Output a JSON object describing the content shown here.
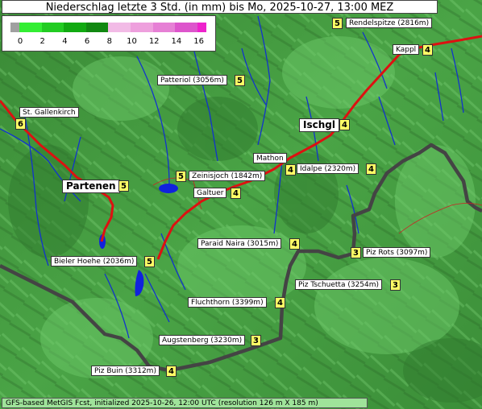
{
  "title": "Niederschlag letzte 3 Std. (in mm) bis Mo, 2025-10-27, 13:00 MEZ",
  "legend": {
    "ticks": [
      "0",
      "2",
      "4",
      "6",
      "8",
      "10",
      "12",
      "14",
      "16"
    ],
    "colors": [
      "#a0a0a0",
      "#33ee33",
      "#22cc22",
      "#11aa11",
      "#118811",
      "#f2bbe6",
      "#eea0dd",
      "#e680d5",
      "#dd55cc",
      "#ee22cc"
    ]
  },
  "places": [
    {
      "name": "Rendelspitze (2816m)",
      "value": "5"
    },
    {
      "name": "Kappl",
      "value": "4"
    },
    {
      "name": "Patteriol (3056m)",
      "value": "5"
    },
    {
      "name": "St. Gallenkirch",
      "value": "6"
    },
    {
      "name": "Ischgl",
      "value": "4"
    },
    {
      "name": "Mathon",
      "value": "4"
    },
    {
      "name": "Idalpe (2320m)",
      "value": "4"
    },
    {
      "name": "Zeinisjoch (1842m)",
      "value": "5"
    },
    {
      "name": "Partenen",
      "value": "5"
    },
    {
      "name": "Galtuer",
      "value": "4"
    },
    {
      "name": "Paraid Naira (3015m)",
      "value": "4"
    },
    {
      "name": "Piz Rots (3097m)",
      "value": "3"
    },
    {
      "name": "Bieler Hoehe (2036m)",
      "value": "5"
    },
    {
      "name": "Piz Tschuetta (3254m)",
      "value": "3"
    },
    {
      "name": "Fluchthorn (3399m)",
      "value": "4"
    },
    {
      "name": "Augstenberg (3230m)",
      "value": "3"
    },
    {
      "name": "Piz Buin (3312m)",
      "value": "4"
    }
  ],
  "footer": "GFS-based MetGIS Fcst, initialized 2025-10-26, 12:00 UTC  (resolution 126 m X 185 m)",
  "colors": {
    "terrain_dark": "#2f7a2e",
    "terrain_light": "#6cc868",
    "road": "#dd1111",
    "border": "#444444",
    "river": "#1133cc",
    "lake": "#1122dd"
  }
}
